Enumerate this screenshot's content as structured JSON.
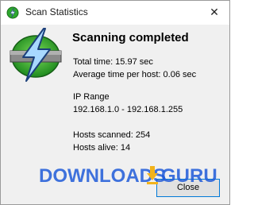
{
  "window": {
    "title": "Scan Statistics",
    "close_glyph": "✕"
  },
  "heading": "Scanning completed",
  "stats": {
    "total_time": "Total time: 15.97 sec",
    "average_time": "Average time per host: 0.06 sec",
    "ip_range_label": "IP Range",
    "ip_range_value": "192.168.1.0 - 192.168.1.255",
    "hosts_scanned": "Hosts scanned: 254",
    "hosts_alive": "Hosts alive: 14"
  },
  "buttons": {
    "close_label": "Close"
  },
  "watermark": {
    "text_left": "DOWNLOADS",
    "text_right": "GURU"
  },
  "icons": {
    "app": "angry-ip-scanner-icon",
    "status": "lightning-bolt-icon"
  },
  "colors": {
    "bolt_fill": "#9fd0ff",
    "ring_green": "#2ea82e",
    "button_border": "#0078d7",
    "watermark_blue": "#1e5bd8"
  }
}
